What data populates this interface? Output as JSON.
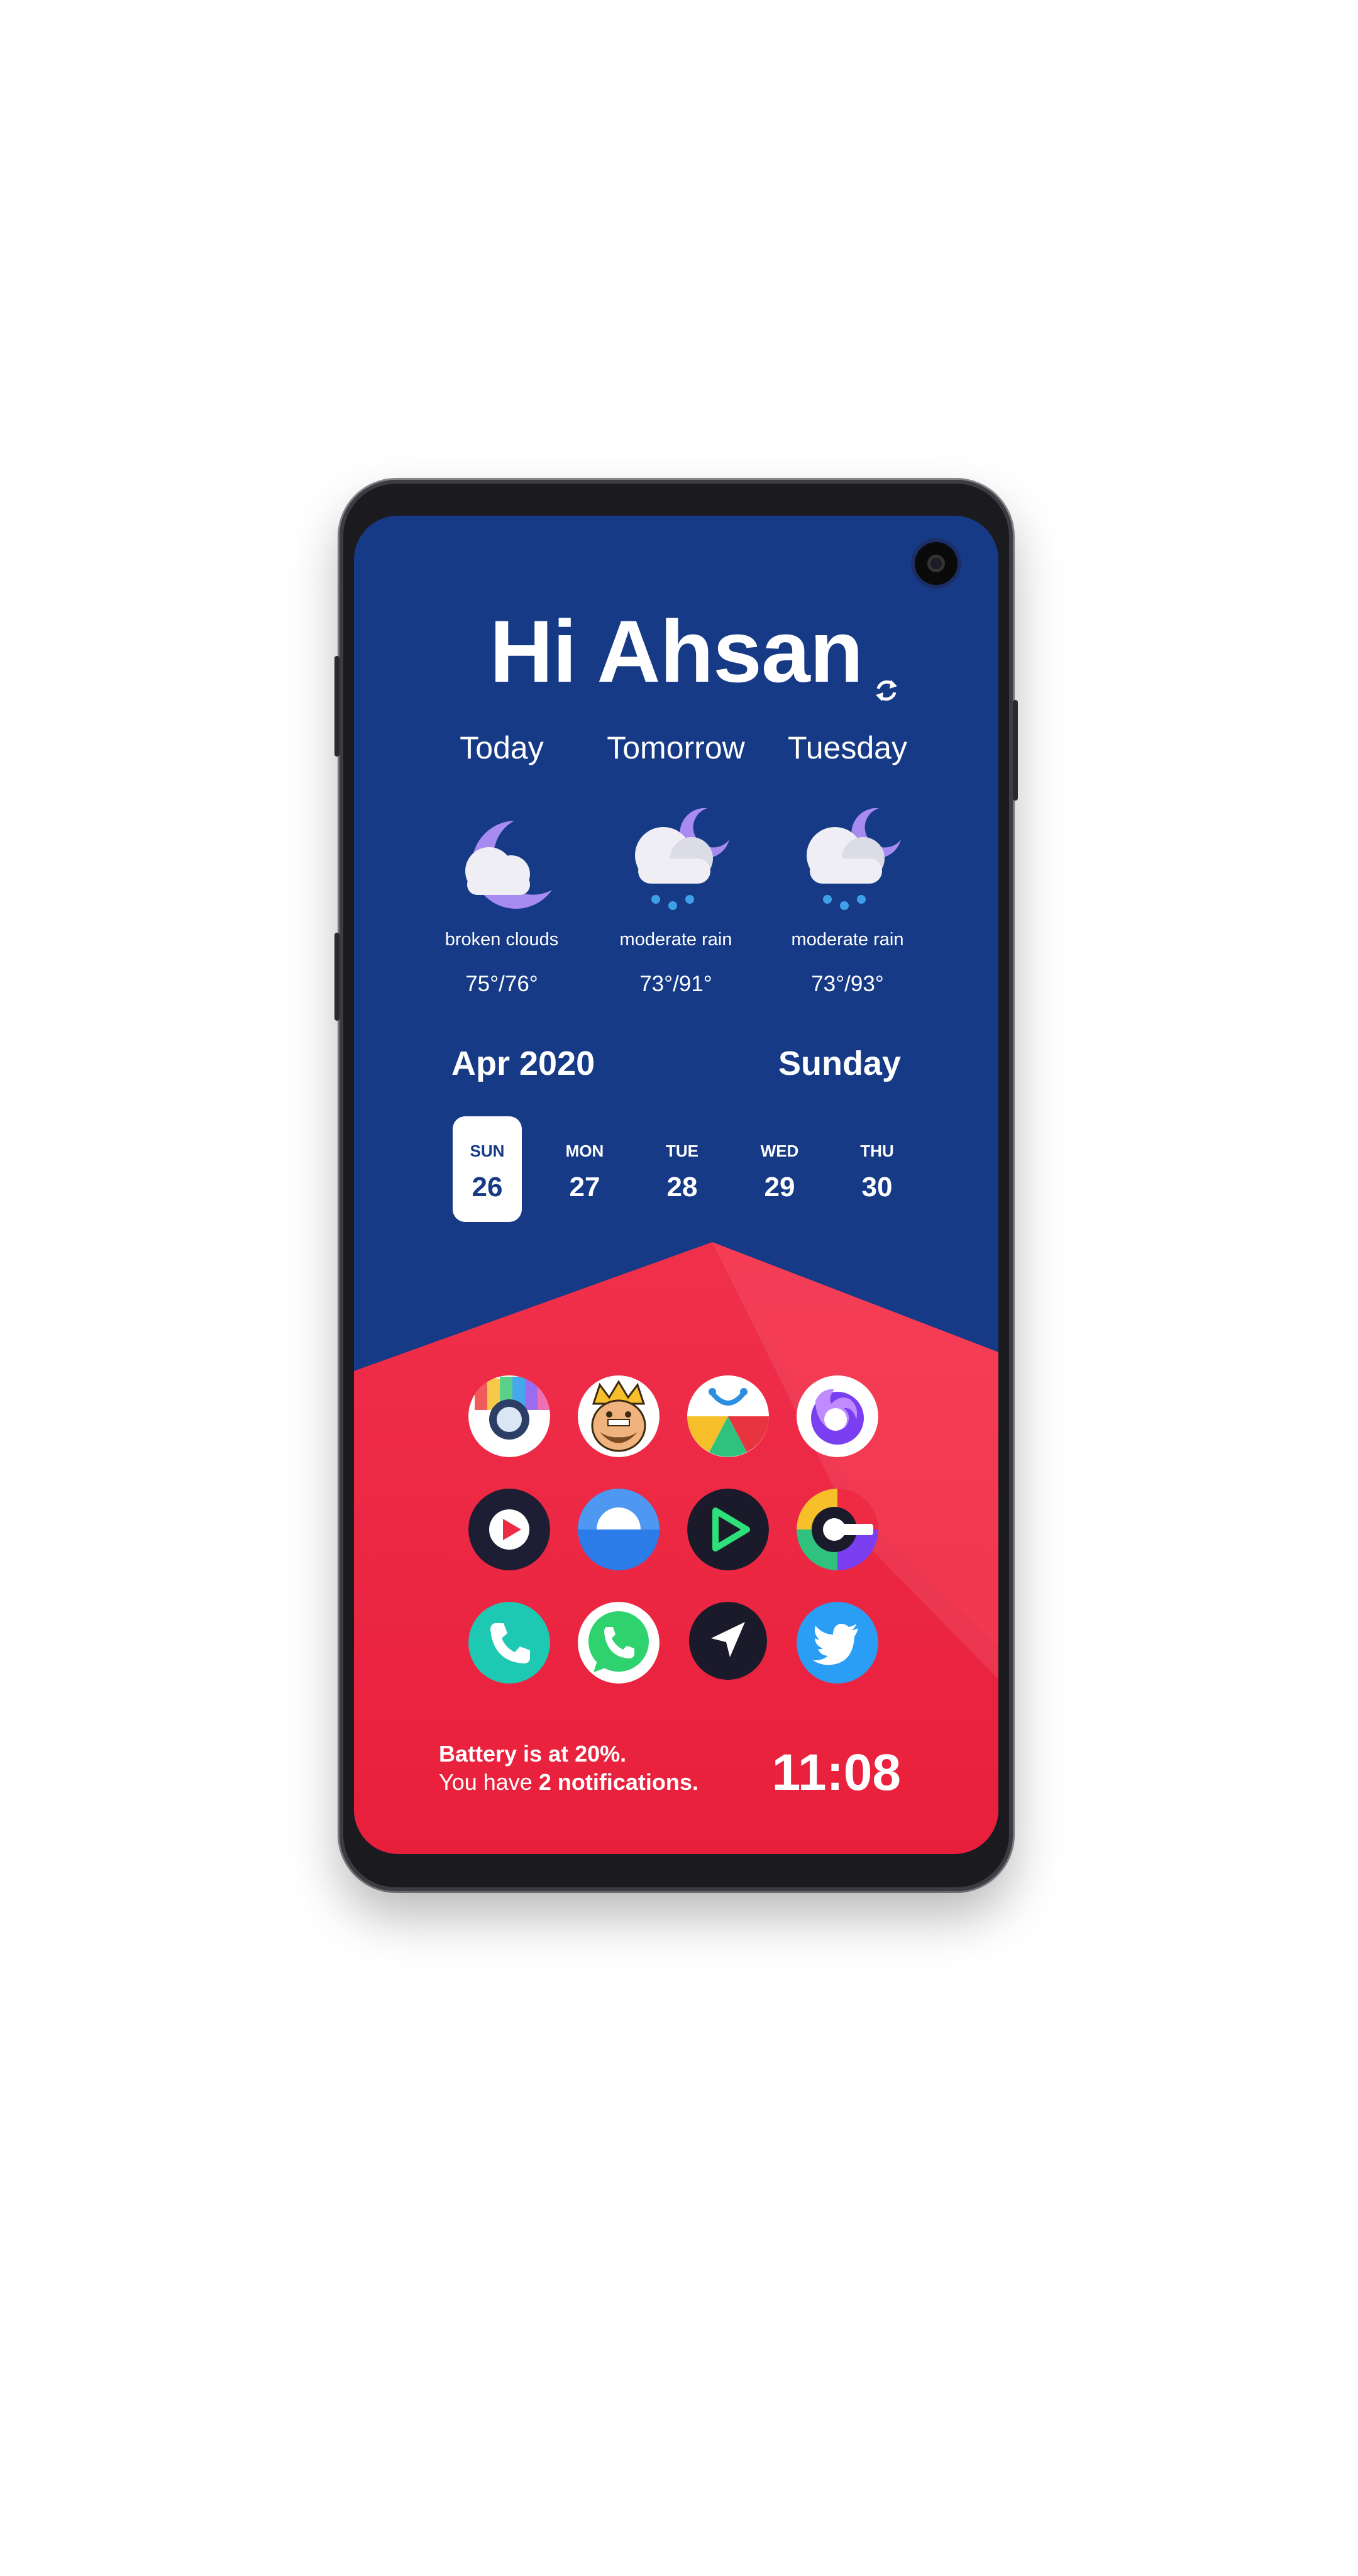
{
  "greeting": "Hi Ahsan",
  "weather": [
    {
      "day": "Today",
      "desc": "broken clouds",
      "temp": "75°/76°",
      "icon": "cloud-moon-icon"
    },
    {
      "day": "Tomorrow",
      "desc": "moderate rain",
      "temp": "73°/91°",
      "icon": "rain-cloud-moon-icon"
    },
    {
      "day": "Tuesday",
      "desc": "moderate rain",
      "temp": "73°/93°",
      "icon": "rain-cloud-moon-icon"
    }
  ],
  "calendar": {
    "month": "Apr 2020",
    "weekday": "Sunday",
    "days": [
      {
        "dow": "SUN",
        "num": "26",
        "active": true
      },
      {
        "dow": "MON",
        "num": "27"
      },
      {
        "dow": "TUE",
        "num": "28"
      },
      {
        "dow": "WED",
        "num": "29"
      },
      {
        "dow": "THU",
        "num": "30"
      }
    ]
  },
  "apps": [
    {
      "name": "camera-app-icon"
    },
    {
      "name": "clash-royale-app-icon"
    },
    {
      "name": "store-app-icon"
    },
    {
      "name": "firefox-app-icon"
    },
    {
      "name": "video-player-app-icon"
    },
    {
      "name": "weather-app-icon"
    },
    {
      "name": "play-app-icon"
    },
    {
      "name": "toggle-app-icon"
    },
    {
      "name": "phone-app-icon"
    },
    {
      "name": "whatsapp-app-icon"
    },
    {
      "name": "navigation-app-icon"
    },
    {
      "name": "twitter-app-icon"
    }
  ],
  "status": {
    "battery": "Battery is at 20%.",
    "notif_prefix": "You have ",
    "notif_count": "2 notifications.",
    "clock": "11:08"
  },
  "colors": {
    "top": "#163a86",
    "bottom": "#ef2a43",
    "accent": "#a78bf0"
  }
}
